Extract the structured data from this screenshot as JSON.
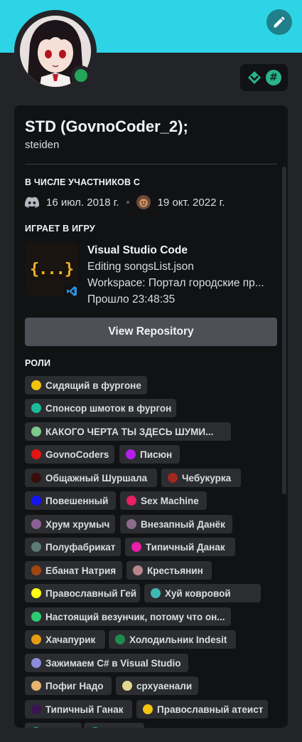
{
  "profile": {
    "display_name": "STD (GovnoCoder_2);",
    "username": "steiden",
    "status_color": "#23a55a",
    "banner_color": "#2dd4e5"
  },
  "icons": {
    "edit": "pencil-icon",
    "badge_1": "hypesquad-diamond-icon",
    "badge_2": "hash-icon",
    "discord": "discord-icon",
    "server": "server-avatar-icon",
    "vscode": "vscode-icon"
  },
  "member_since": {
    "title": "В ЧИСЛЕ УЧАСТНИКОВ С",
    "discord_date": "16 июл. 2018 г.",
    "server_date": "19 окт. 2022 г."
  },
  "activity": {
    "title": "ИГРАЕТ В ИГРУ",
    "icon_text": "{...}",
    "name": "Visual Studio Code",
    "details": "Editing songsList.json",
    "state": "Workspace: Портал городские пр...",
    "elapsed": "Прошло 23:48:35",
    "button_label": "View Repository"
  },
  "roles_title": "РОЛИ",
  "badge_hash_glyph": "#",
  "roles": [
    {
      "name": "Сидящий в фургоне",
      "color": "#f1c40f"
    },
    {
      "name": "Спонсор шмоток в фургон",
      "color": "#1abc9c"
    },
    {
      "name": "КАКОГО ЧЕРТА ТЫ ЗДЕСЬ ШУМИ...",
      "color": "#7fc98a"
    },
    {
      "name": "GovnoCoders",
      "color": "#e61414"
    },
    {
      "name": "Писюн",
      "color": "#b51fe6"
    },
    {
      "name": "Общажный Шуршала",
      "color": "#3a0d0d"
    },
    {
      "name": "Чебукурка",
      "color": "#a0281e"
    },
    {
      "name": "Повешенный",
      "color": "#1414f0"
    },
    {
      "name": "Sex Machine",
      "color": "#e91e63"
    },
    {
      "name": "Хрум хрумыч",
      "color": "#8b6096"
    },
    {
      "name": "Внезапный Данёк",
      "color": "#8e6b8e"
    },
    {
      "name": "Полуфабрикат",
      "color": "#5e7a72"
    },
    {
      "name": "Типичный Данак",
      "color": "#e91eaa"
    },
    {
      "name": "Ебанат Натрия",
      "color": "#a0460f"
    },
    {
      "name": "Крестьянин",
      "color": "#b8868a"
    },
    {
      "name": "Православный Гей",
      "color": "#ffff14"
    },
    {
      "name": "Хуй ковровой",
      "color": "#3fb8b0"
    },
    {
      "name": "Настоящий везунчик, потому что он...",
      "color": "#2ecc71"
    },
    {
      "name": "Хачапурик",
      "color": "#e69b14"
    },
    {
      "name": "Холодильник Indesit",
      "color": "#1f8b4c"
    },
    {
      "name": "Зажимаем C# в Visual Studio",
      "color": "#8c8cdc"
    },
    {
      "name": "Пофиг Надо",
      "color": "#e6b472"
    },
    {
      "name": "срхуаенали",
      "color": "#e0d890"
    },
    {
      "name": "Типичный Ганак",
      "color": "#3c1450"
    },
    {
      "name": "Православный атеист",
      "color": "#f1c40f"
    },
    {
      "name": "",
      "color": "#1abc9c"
    },
    {
      "name": "",
      "color": "#1abc9c"
    }
  ]
}
